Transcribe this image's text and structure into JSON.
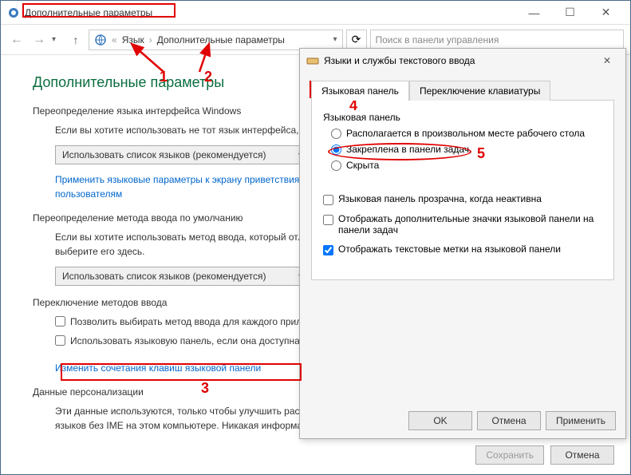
{
  "window": {
    "title": "Дополнительные параметры",
    "min": "—",
    "max": "☐",
    "close": "✕"
  },
  "nav": {
    "back": "←",
    "forward": "→",
    "dropdown": "▾",
    "expand": "▾",
    "refresh": "⟳"
  },
  "breadcrumb": {
    "sep1": "«",
    "item1": "Язык",
    "sep2": "›",
    "item2": "Дополнительные параметры"
  },
  "search": {
    "placeholder": "Поиск в панели управления"
  },
  "page": {
    "heading": "Дополнительные параметры",
    "sec1_title": "Переопределение языка интерфейса Windows",
    "sec1_text": "Если вы хотите использовать не тот язык интерфейса,",
    "sec1_dropdown": "Использовать список языков (рекомендуется)",
    "sec1_link": "Применить языковые параметры к экрану приветствия, системным учетным записям и новым пользователям",
    "sec2_title": "Переопределение метода ввода по умолчанию",
    "sec2_text": "Если вы хотите использовать метод ввода, который отличается от первого метода в списке языков, выберите его здесь.",
    "sec2_dropdown": "Использовать список языков (рекомендуется)",
    "sec3_title": "Переключение методов ввода",
    "sec3_cb1": "Позволить выбирать метод ввода для каждого приложения",
    "sec3_cb2": "Использовать языковую панель, если она доступна",
    "sec3_link": "Изменить сочетания клавиш языковой панели",
    "sec4_title": "Данные персонализации",
    "sec4_text": "Эти данные используются, только чтобы улучшить распознавание рукописного ввода и предложения для языков без IME на этом компьютере. Никакая информация"
  },
  "footer": {
    "save": "Сохранить",
    "cancel": "Отмена"
  },
  "dialog": {
    "title": "Языки и службы текстового ввода",
    "close": "✕",
    "tab1": "Языковая панель",
    "tab2": "Переключение клавиатуры",
    "group": "Языковая панель",
    "radio1": "Располагается в произвольном месте рабочего стола",
    "radio2": "Закреплена в панели задач",
    "radio3": "Скрыта",
    "cb1": "Языковая панель прозрачна, когда неактивна",
    "cb2": "Отображать дополнительные значки языковой панели на панели задач",
    "cb3": "Отображать текстовые метки на языковой панели",
    "ok": "OK",
    "cancel": "Отмена",
    "apply": "Применить"
  },
  "annotations": {
    "n1": "1",
    "n2": "2",
    "n3": "3",
    "n4": "4",
    "n5": "5"
  },
  "colors": {
    "accent_green": "#0a6e3f",
    "link_blue": "#0066cc",
    "anno_red": "#e00000"
  }
}
